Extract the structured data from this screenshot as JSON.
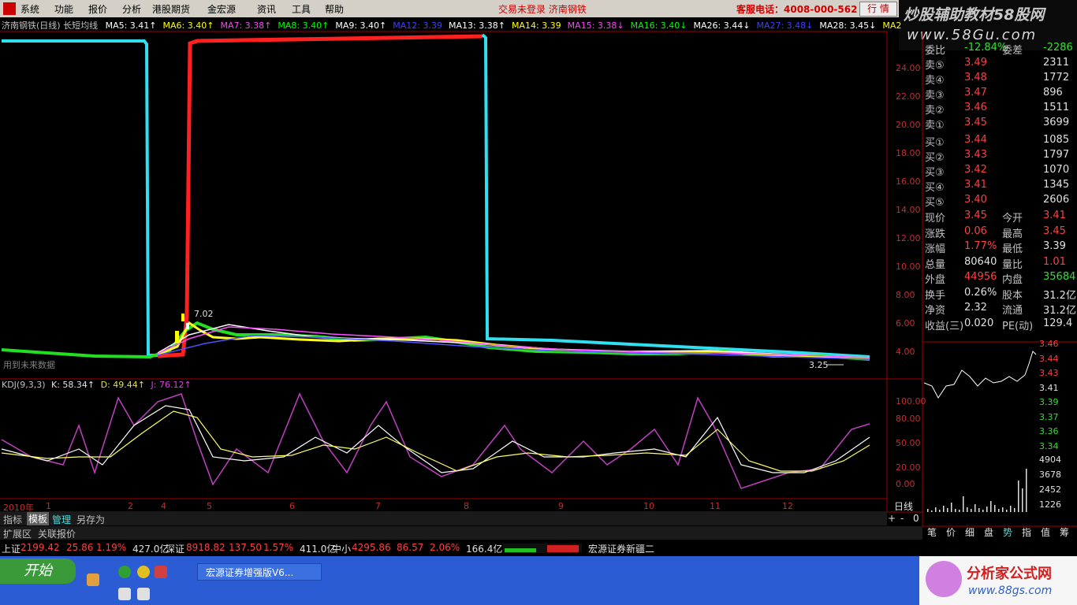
{
  "menu": [
    "系统",
    "功能",
    "报价",
    "分析",
    "港股期货",
    "金宏源",
    "资讯",
    "工具",
    "帮助"
  ],
  "notice": "交易未登录 济南钢铁",
  "hotline": "客服电话：4008-000-562",
  "quote_button": "行 情",
  "watermark_top": {
    "brand": "炒股辅助教材58股网",
    "site": "www.58Gu.com"
  },
  "chart": {
    "title": "济南钢铁(日线) 长短均线",
    "ma_labels": [
      "MA5: 3.41↑",
      "MA6: 3.40↑",
      "MA7: 3.38↑",
      "MA8: 3.40↑",
      "MA9: 3.40↑",
      "MA12: 3.39",
      "MA13: 3.38↑",
      "MA14: 3.39",
      "MA15: 3.38↓",
      "MA16: 3.40↓",
      "MA26: 3.44↓",
      "MA27: 3.48↓",
      "MA28: 3.45↓",
      "MA2"
    ],
    "ma_colors": [
      "#ffffff",
      "#ffff00",
      "#ff40ff",
      "#00ff00",
      "#ffffff",
      "#4040ff",
      "#ffffff",
      "#ffff00",
      "#ff40ff",
      "#00ff00",
      "#ffffff",
      "#4040ff",
      "#ffffff",
      "#ffff00"
    ],
    "price_ticks": [
      "24.00",
      "22.00",
      "20.00",
      "18.00",
      "16.00",
      "14.00",
      "12.00",
      "10.00",
      "8.00",
      "6.00",
      "4.00"
    ],
    "peak_label": "7.02",
    "last_label": "3.25",
    "future_note": "用到未来数据",
    "kdj_header": {
      "name": "KDJ(9,3,3)",
      "k": "K: 58.34↑",
      "d": "D: 49.44↑",
      "j": "J: 76.12↑"
    },
    "kdj_ticks": [
      "100.00",
      "80.00",
      "50.00",
      "20.00",
      "0.00"
    ],
    "months": [
      "2010年",
      "1",
      "2",
      "4",
      "5",
      "6",
      "7",
      "8",
      "9",
      "10",
      "11",
      "12"
    ],
    "period": "日线"
  },
  "order_book": {
    "head": {
      "l1": "委比",
      "v1": "-12.84%",
      "l2": "委差",
      "v2": "-2286"
    },
    "sell": [
      {
        "label": "卖⑤",
        "price": "3.49",
        "vol": "2311"
      },
      {
        "label": "卖④",
        "price": "3.48",
        "vol": "1772"
      },
      {
        "label": "卖③",
        "price": "3.47",
        "vol": "896"
      },
      {
        "label": "卖②",
        "price": "3.46",
        "vol": "1511"
      },
      {
        "label": "卖①",
        "price": "3.45",
        "vol": "3699"
      }
    ],
    "buy": [
      {
        "label": "买①",
        "price": "3.44",
        "vol": "1085"
      },
      {
        "label": "买②",
        "price": "3.43",
        "vol": "1797"
      },
      {
        "label": "买③",
        "price": "3.42",
        "vol": "1070"
      },
      {
        "label": "买④",
        "price": "3.41",
        "vol": "1345"
      },
      {
        "label": "买⑤",
        "price": "3.40",
        "vol": "2606"
      }
    ],
    "stats": [
      {
        "l1": "现价",
        "v1": "3.45",
        "l2": "今开",
        "v2": "3.41"
      },
      {
        "l1": "涨跌",
        "v1": "0.06",
        "l2": "最高",
        "v2": "3.45"
      },
      {
        "l1": "涨幅",
        "v1": "1.77%",
        "l2": "最低",
        "v2": "3.39"
      },
      {
        "l1": "总量",
        "v1": "80640",
        "l2": "量比",
        "v2": "1.01"
      },
      {
        "l1": "外盘",
        "v1": "44956",
        "l2": "内盘",
        "v2": "35684"
      },
      {
        "l1": "换手",
        "v1": "0.26%",
        "l2": "股本",
        "v2": "31.2亿"
      },
      {
        "l1": "净资",
        "v1": "2.32",
        "l2": "流通",
        "v2": "31.2亿"
      },
      {
        "l1": "收益(三)",
        "v1": "0.020",
        "l2": "PE(动)",
        "v2": "129.4"
      }
    ],
    "mini_ticks": [
      "3.46",
      "3.44",
      "3.43",
      "3.41",
      "3.39",
      "3.37",
      "3.36",
      "3.34"
    ],
    "vol_ticks": [
      "4904",
      "3678",
      "2452",
      "1226"
    ]
  },
  "bottom_tabs": [
    "指标",
    "模板",
    "管理",
    "另存为"
  ],
  "bottom_tabs2": [
    "扩展区",
    "关联报价"
  ],
  "zoom_buttons": [
    "+",
    "-",
    "0"
  ],
  "side_tabs": [
    "笔",
    "价",
    "细",
    "盘",
    "势",
    "指",
    "值",
    "筹"
  ],
  "status": {
    "sh": {
      "name": "上证",
      "val": "2199.42",
      "chg": "25.86",
      "pct": "1.19%",
      "amt": "427.0亿"
    },
    "sz": {
      "name": "深证",
      "val": "8918.82",
      "chg": "137.50",
      "pct": "1.57%",
      "amt": "411.0亿"
    },
    "zx": {
      "name": "中小",
      "val": "4295.86",
      "chg": "86.57",
      "pct": "2.06%",
      "amt": "166.4亿"
    },
    "broker": "宏源证券新疆二"
  },
  "taskbar": {
    "start": "开始",
    "task": "宏源证券增强版V6..."
  },
  "watermark_bottom": {
    "t1": "分析家公式网",
    "t2": "www.88gs.com"
  }
}
